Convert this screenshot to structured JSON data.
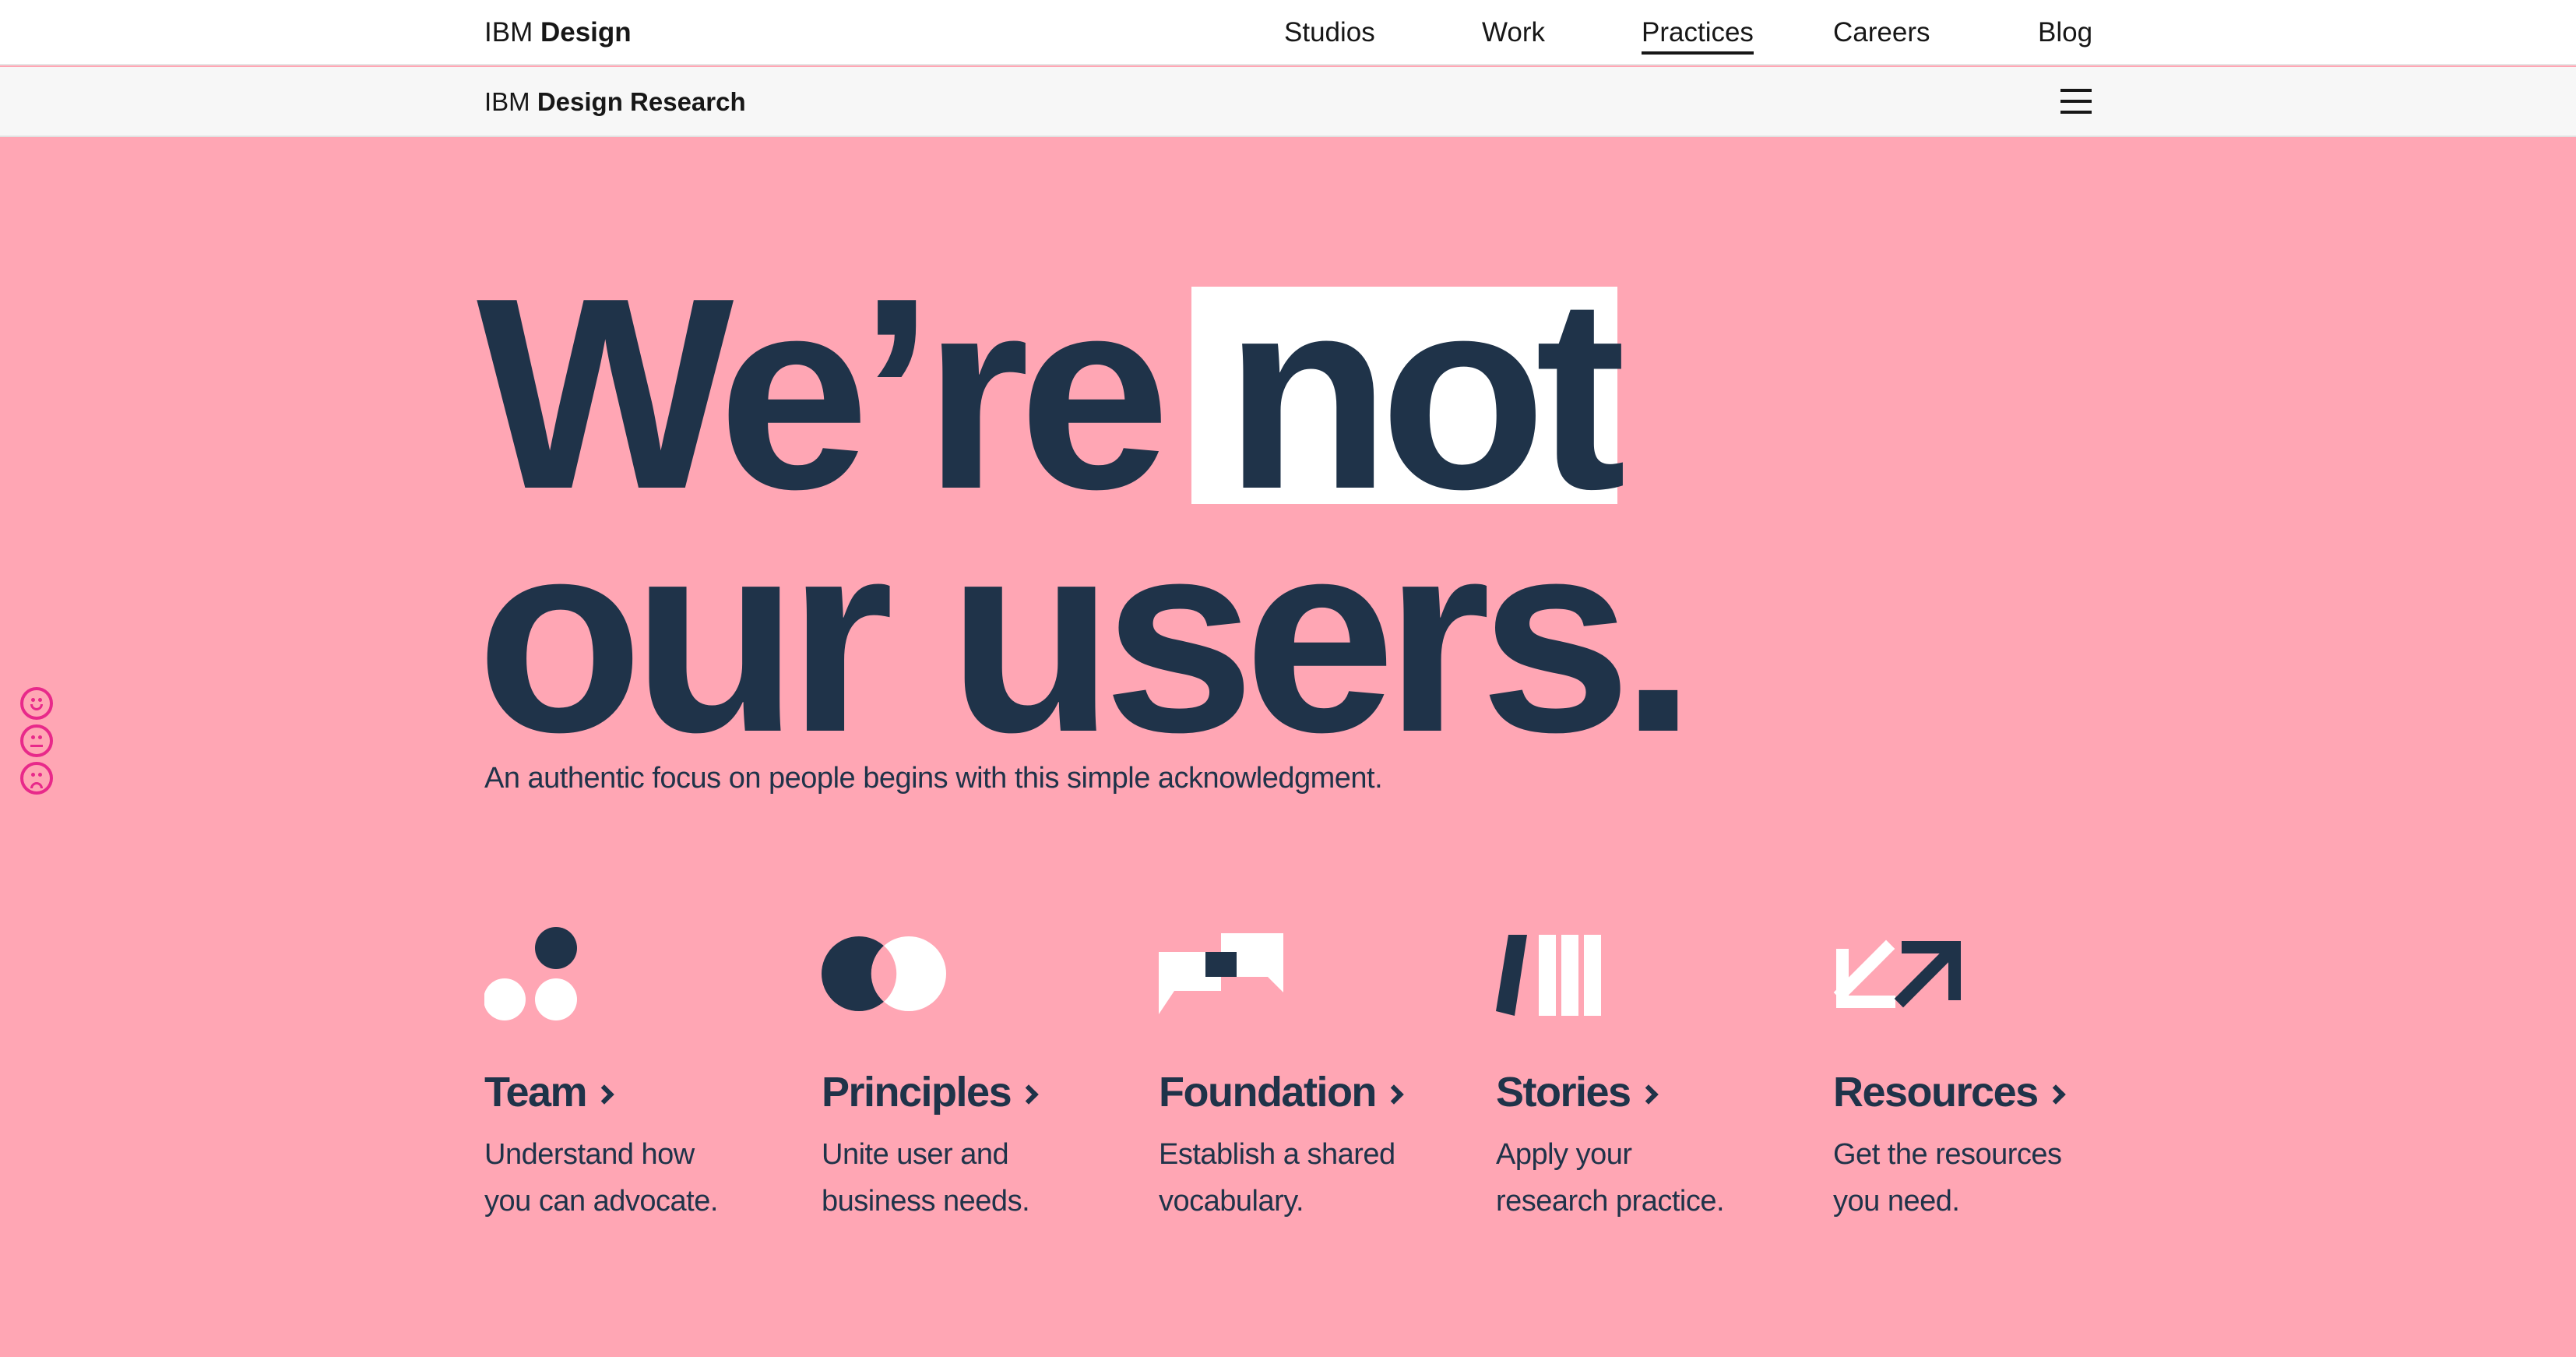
{
  "header": {
    "brand_prefix": "IBM",
    "brand_name": "Design",
    "nav": [
      {
        "label": "Studios",
        "active": false
      },
      {
        "label": "Work",
        "active": false
      },
      {
        "label": "Practices",
        "active": true
      },
      {
        "label": "Careers",
        "active": false
      },
      {
        "label": "Blog",
        "active": false
      }
    ]
  },
  "subheader": {
    "brand_prefix": "IBM",
    "brand_name": "Design Research",
    "menu_icon": "hamburger-menu-icon"
  },
  "hero": {
    "line1_a": "We’re ",
    "line1_highlight": "not",
    "line2": "our users.",
    "lead": "An authentic focus on people begins with this simple acknowledgment."
  },
  "feedback": {
    "icons": [
      "smile-icon",
      "neutral-face-icon",
      "sad-face-icon"
    ],
    "color": "#e8298a"
  },
  "cards": [
    {
      "title": "Team",
      "desc1": "Understand how",
      "desc2": "you can advocate.",
      "icon": "team-dots-icon"
    },
    {
      "title": "Principles",
      "desc1": "Unite user and",
      "desc2": "business needs.",
      "icon": "venn-circles-icon"
    },
    {
      "title": "Foundation",
      "desc1": "Establish a shared",
      "desc2": "vocabulary.",
      "icon": "speech-bubbles-icon"
    },
    {
      "title": "Stories",
      "desc1": "Apply your",
      "desc2": "research practice.",
      "icon": "book-spines-icon"
    },
    {
      "title": "Resources",
      "desc1": "Get the resources",
      "desc2": "you need.",
      "icon": "arrows-in-out-icon"
    }
  ],
  "colors": {
    "background": "#ffa6b4",
    "navy": "#1f3349",
    "white": "#ffffff"
  }
}
